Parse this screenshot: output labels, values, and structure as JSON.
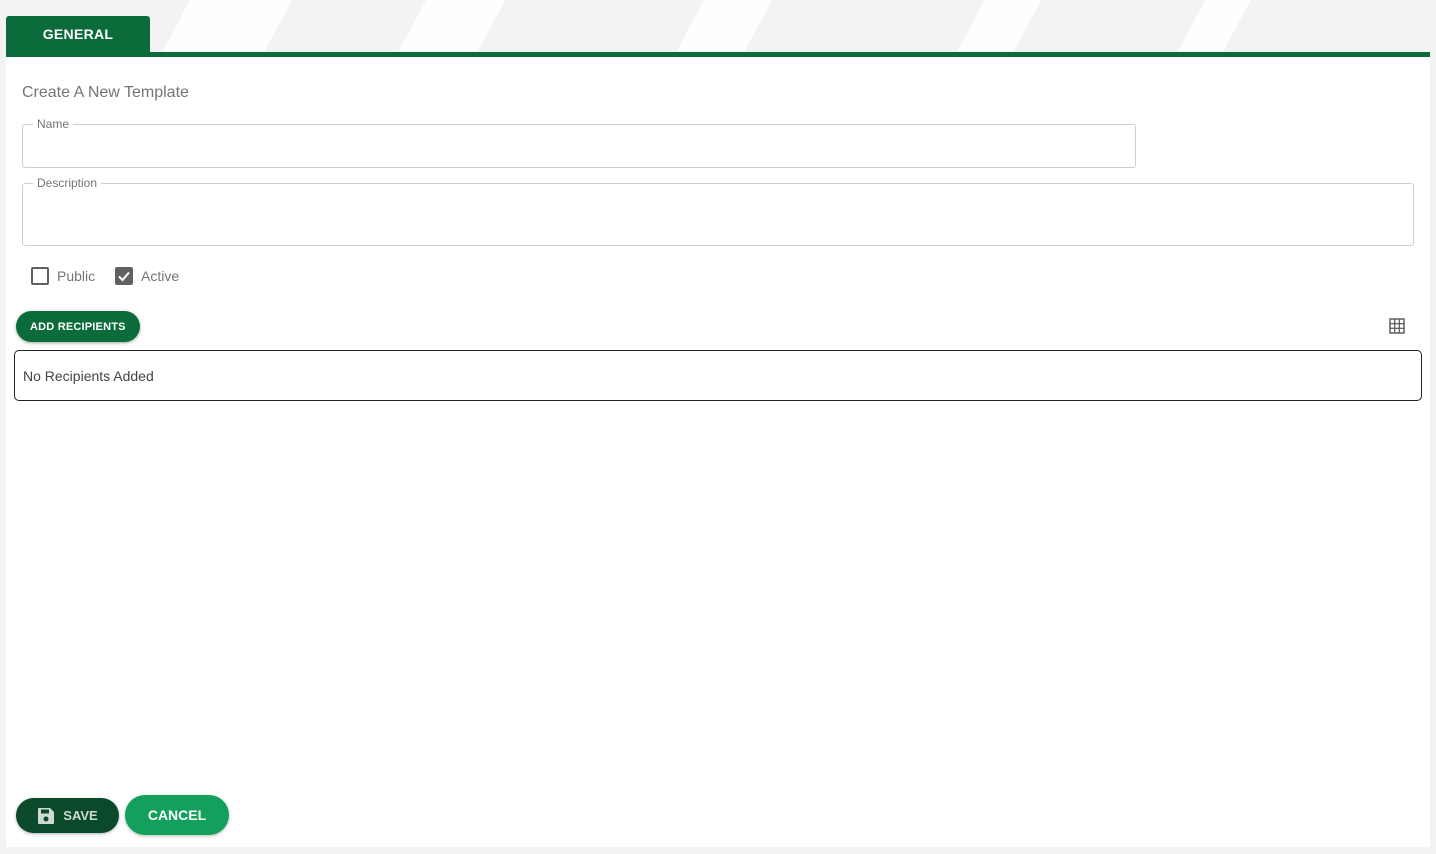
{
  "tabs": [
    {
      "label": "GENERAL",
      "active": true
    }
  ],
  "form": {
    "heading": "Create A New Template",
    "name": {
      "label": "Name",
      "value": "",
      "required": true
    },
    "description": {
      "label": "Description",
      "value": ""
    },
    "public": {
      "label": "Public",
      "checked": false
    },
    "active": {
      "label": "Active",
      "checked": true
    }
  },
  "recipients": {
    "add_label": "ADD RECIPIENTS",
    "empty_text": "No Recipients Added",
    "view_icon": "grid-icon"
  },
  "actions": {
    "save_label": "SAVE",
    "save_icon": "floppy-disk-icon",
    "cancel_label": "CANCEL"
  },
  "colors": {
    "primary": "#0b6b3a",
    "save": "#0a4a2a",
    "cancel": "#12a05c",
    "required": "#c62828"
  }
}
